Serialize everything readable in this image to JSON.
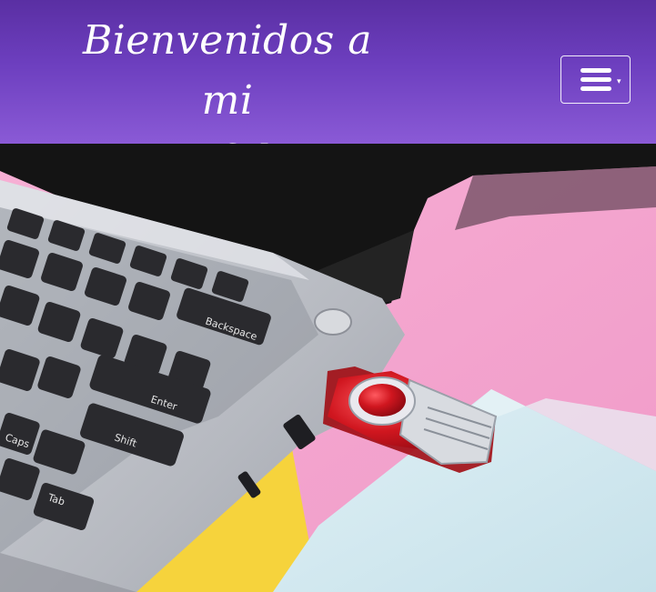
{
  "header": {
    "title_line1": "Bienvenidos a mi",
    "title_line2": "Porfolio",
    "menu_icon": "hamburger-menu-icon"
  },
  "hero": {
    "image_subject": "laptop-with-usb-drive",
    "colors": {
      "header_top": "#5a2fa3",
      "header_bottom": "#8a5ad6",
      "laptop": "#b9bcc4",
      "keys": "#2a2a2e",
      "pink": "#f3a6cf",
      "yellow": "#f6d33c",
      "paper_blue": "#cfe6ef",
      "usb_red": "#c8141c"
    },
    "key_labels": {
      "backspace": "Backspace",
      "enter": "Enter",
      "shift": "Shift",
      "tab": "Tab",
      "caps": "Caps"
    }
  }
}
